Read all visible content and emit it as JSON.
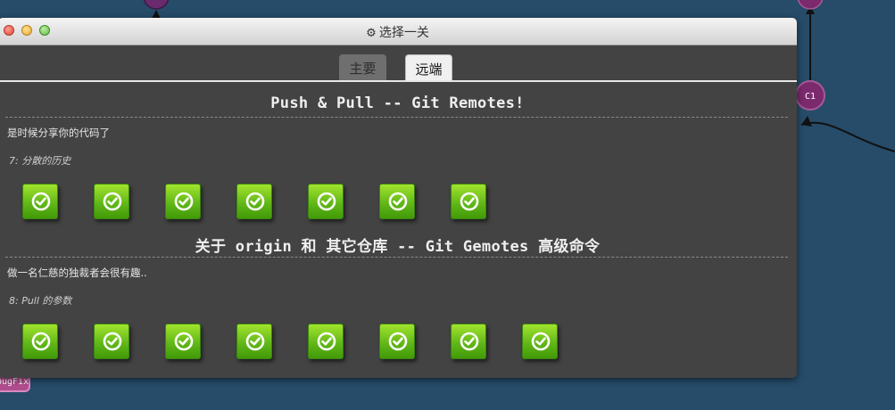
{
  "background": {
    "commit_label": "C1",
    "branch_label": "bugFix"
  },
  "window": {
    "title": "选择一关",
    "title_icon": "gear-icon"
  },
  "tabs": [
    {
      "label": "主要",
      "selected": false
    },
    {
      "label": "远端",
      "selected": true
    }
  ],
  "sections": [
    {
      "title": "Push & Pull -- Git Remotes!",
      "description": "是时候分享你的代码了",
      "sequence_label": "7: 分散的历史",
      "level_count": 7,
      "levels_completed": 7
    },
    {
      "title": "关于 origin 和 其它仓库 -- Git Gemotes 高级命令",
      "description": "做一名仁慈的独裁者会很有趣..",
      "sequence_label": "8: Pull 的参数",
      "level_count": 8,
      "levels_completed": 8
    }
  ],
  "colors": {
    "desktop": "#264c6a",
    "window_body": "#434343",
    "level_complete": "#62b818",
    "commit_node": "#7b2a6d"
  },
  "icons": {
    "level": "checkmark-icon"
  }
}
